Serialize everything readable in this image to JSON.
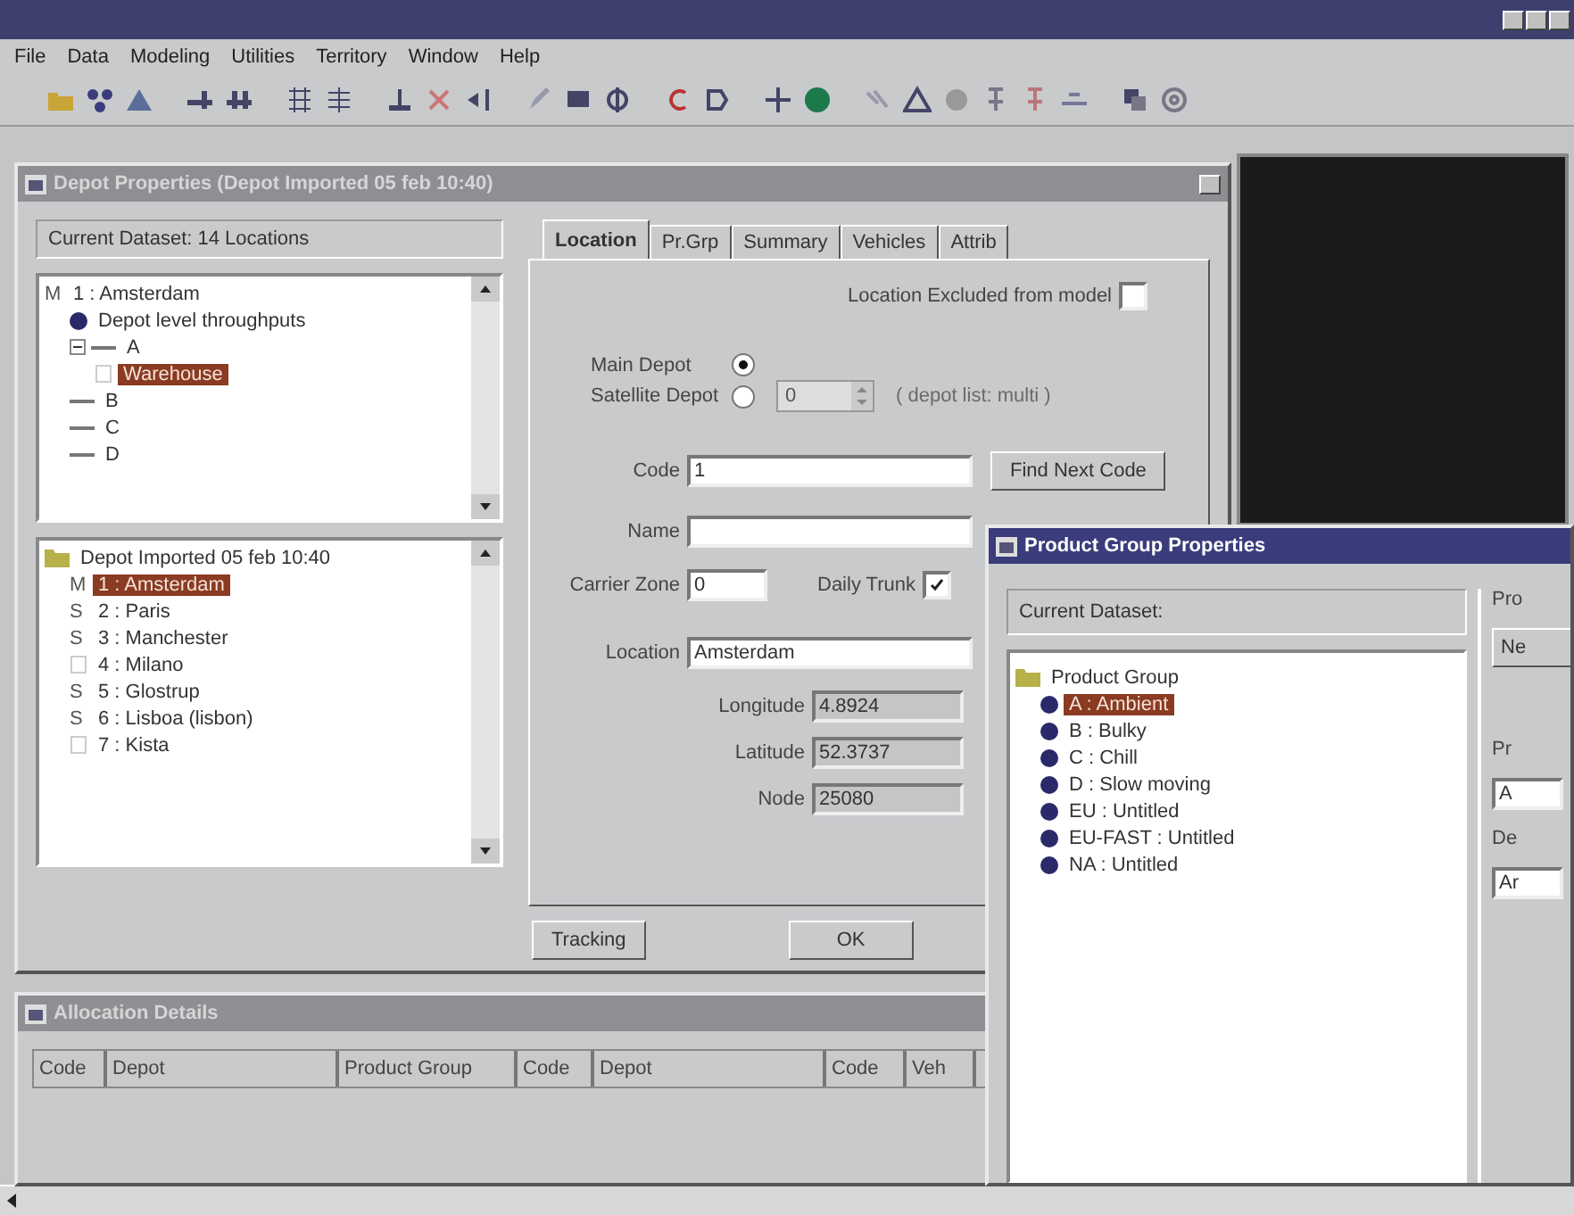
{
  "menu": [
    {
      "label": "File"
    },
    {
      "label": "Data"
    },
    {
      "label": "Modeling"
    },
    {
      "label": "Utilities"
    },
    {
      "label": "Territory"
    },
    {
      "label": "Window"
    },
    {
      "label": "Help"
    }
  ],
  "depot_window": {
    "title": "Depot Properties (Depot Imported 05 feb 10:40)",
    "active": false,
    "dataset_label": "Current Dataset: 14 Locations",
    "location_tree": [
      {
        "kind": "letter",
        "prefix": "M",
        "label": "1 : Amsterdam",
        "selected": false,
        "children": [
          {
            "kind": "dot",
            "label": "Depot level throughputs",
            "selected": false
          },
          {
            "kind": "dash",
            "label": "A",
            "selected": false,
            "expanded": true,
            "children": [
              {
                "kind": "blank",
                "label": "Warehouse",
                "selected": true
              }
            ]
          },
          {
            "kind": "dash",
            "label": "B",
            "selected": false
          },
          {
            "kind": "dash",
            "label": "C",
            "selected": false
          },
          {
            "kind": "dash",
            "label": "D",
            "selected": false
          }
        ]
      }
    ],
    "depot_tree": [
      {
        "kind": "folder",
        "label": "Depot Imported 05 feb 10:40",
        "selected": false,
        "children": [
          {
            "kind": "letter",
            "prefix": "M",
            "label": "1 : Amsterdam",
            "selected": true
          },
          {
            "kind": "letter",
            "prefix": "S",
            "label": "2 : Paris",
            "selected": false
          },
          {
            "kind": "letter",
            "prefix": "S",
            "label": "3 : Manchester",
            "selected": false
          },
          {
            "kind": "blank",
            "label": "4 : Milano",
            "selected": false
          },
          {
            "kind": "letter",
            "prefix": "S",
            "label": "5 : Glostrup",
            "selected": false
          },
          {
            "kind": "letter",
            "prefix": "S",
            "label": "6 : Lisboa (lisbon)",
            "selected": false
          },
          {
            "kind": "blank",
            "label": "7 : Kista",
            "selected": false
          }
        ]
      }
    ],
    "tabs": [
      {
        "label": "Location",
        "selected": true
      },
      {
        "label": "Pr.Grp",
        "selected": false
      },
      {
        "label": "Summary",
        "selected": false
      },
      {
        "label": "Vehicles",
        "selected": false
      },
      {
        "label": "Attrib",
        "selected": false
      }
    ],
    "excluded": {
      "label": "Location Excluded from model",
      "checked": false
    },
    "depot_type": [
      {
        "label": "Main Depot",
        "selected": true
      },
      {
        "label": "Satellite Depot",
        "selected": false
      }
    ],
    "spinner": {
      "value": "0",
      "disabled": true
    },
    "depot_note": "( depot list: multi )",
    "code": {
      "label": "Code",
      "value": "1"
    },
    "find_button": "Find Next Code",
    "name": {
      "label": "Name"
    },
    "carrier_zone": {
      "label": "Carrier Zone",
      "value": "0"
    },
    "daily_trunk": {
      "label": "Daily Trunk",
      "checked": true
    },
    "location": {
      "label": "Location",
      "value": "Amsterdam"
    },
    "coordinates": [
      {
        "label": "Longitude",
        "value": "4.8924"
      },
      {
        "label": "Latitude",
        "value": "52.3737"
      },
      {
        "label": "Node",
        "value": "25080"
      }
    ],
    "buttons": [
      "Tracking",
      "OK"
    ]
  },
  "allocation_window": {
    "title": "Allocation Details",
    "active": false,
    "columns": [
      "Code",
      "Depot",
      "Product Group",
      "Code",
      "Depot",
      "Code",
      "Veh"
    ]
  },
  "product_window": {
    "title": "Product Group Properties",
    "active": true,
    "dataset_label": "Current Dataset:",
    "tree": [
      {
        "kind": "folder",
        "label": "Product Group",
        "selected": false,
        "children": [
          {
            "kind": "dot",
            "label": "A : Ambient",
            "selected": true
          },
          {
            "kind": "dot",
            "label": "B : Bulky",
            "selected": false
          },
          {
            "kind": "dot",
            "label": "C : Chill",
            "selected": false
          },
          {
            "kind": "dot",
            "label": "D : Slow moving",
            "selected": false
          },
          {
            "kind": "dot",
            "label": "EU : Untitled",
            "selected": false
          },
          {
            "kind": "dot",
            "label": "EU-FAST : Untitled",
            "selected": false
          },
          {
            "kind": "dot",
            "label": "NA : Untitled",
            "selected": false
          }
        ]
      }
    ],
    "side": {
      "heading": "Pro",
      "button": "Ne",
      "fields": [
        {
          "label": "Pr",
          "value": "A"
        },
        {
          "label": "De",
          "value": "Ar"
        }
      ]
    }
  }
}
